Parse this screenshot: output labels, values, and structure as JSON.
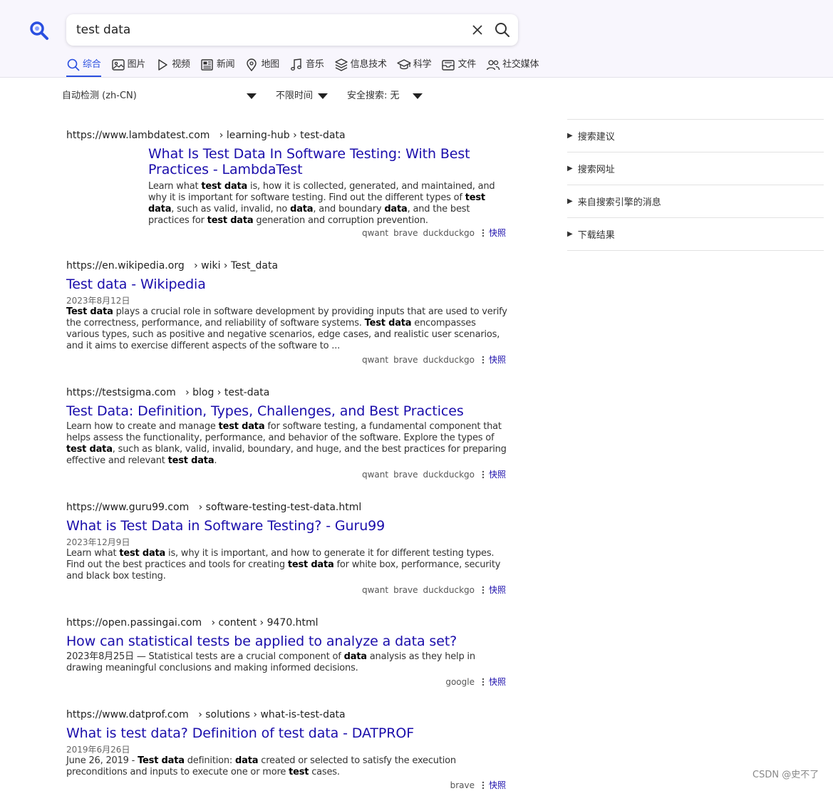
{
  "search": {
    "query": "test data",
    "clear_icon": "close-icon",
    "submit_icon": "search-icon"
  },
  "tabs": [
    {
      "label": "综合",
      "icon": "search-icon",
      "active": true
    },
    {
      "label": "图片",
      "icon": "image-icon"
    },
    {
      "label": "视频",
      "icon": "play-icon"
    },
    {
      "label": "新闻",
      "icon": "newspaper-icon"
    },
    {
      "label": "地图",
      "icon": "map-pin-icon"
    },
    {
      "label": "音乐",
      "icon": "music-icon"
    },
    {
      "label": "信息技术",
      "icon": "layers-icon"
    },
    {
      "label": "科学",
      "icon": "graduation-cap-icon"
    },
    {
      "label": "文件",
      "icon": "inbox-icon"
    },
    {
      "label": "社交媒体",
      "icon": "users-icon"
    }
  ],
  "filters": {
    "language": "自动检测 (zh-CN)",
    "time": "不限时间",
    "safe_search": "安全搜索: 无"
  },
  "results": [
    {
      "domain": "https://www.lambdatest.com",
      "path": "› learning-hub › test-data",
      "title": "What Is Test Data In Software Testing: With Best Practices - LambdaTest",
      "date": "",
      "snippet": "Learn what <b>test data</b> is, how it is collected, generated, and maintained, and why it is important for software testing. Find out the different types of <b>test data</b>, such as valid, invalid, no <b>data</b>, and boundary <b>data</b>, and the best practices for <b>test data</b> generation and corruption prevention.",
      "sources": [
        "qwant",
        "brave",
        "duckduckgo"
      ],
      "snapshot": "快照"
    },
    {
      "domain": "https://en.wikipedia.org",
      "path": "› wiki › Test_data",
      "title": "Test data - Wikipedia",
      "date": "2023年8月12日",
      "snippet": "<b>Test data</b> plays a crucial role in software development by providing inputs that are used to verify the correctness, performance, and reliability of software systems. <b>Test data</b> encompasses various types, such as positive and negative scenarios, edge cases, and realistic user scenarios, and it aims to exercise different aspects of the software to ...",
      "sources": [
        "qwant",
        "brave",
        "duckduckgo"
      ],
      "snapshot": "快照"
    },
    {
      "domain": "https://testsigma.com",
      "path": "› blog › test-data",
      "title": "Test Data: Definition, Types, Challenges, and Best Practices",
      "date": "",
      "snippet": "Learn how to create and manage <b>test data</b> for software testing, a fundamental component that helps assess the functionality, performance, and behavior of the software. Explore the types of <b>test data</b>, such as blank, valid, invalid, boundary, and huge, and the best practices for preparing effective and relevant <b>test data</b>.",
      "sources": [
        "qwant",
        "brave",
        "duckduckgo"
      ],
      "snapshot": "快照"
    },
    {
      "domain": "https://www.guru99.com",
      "path": "› software-testing-test-data.html",
      "title": "What is Test Data in Software Testing? - Guru99",
      "date": "2023年12月9日",
      "snippet": "Learn what <b>test data</b> is, why it is important, and how to generate it for different testing types. Find out the best practices and tools for creating <b>test data</b> for white box, performance, security and black box testing.",
      "sources": [
        "qwant",
        "brave",
        "duckduckgo"
      ],
      "snapshot": "快照"
    },
    {
      "domain": "https://open.passingai.com",
      "path": "› content › 9470.html",
      "title": "How can statistical tests be applied to analyze a data set?",
      "date": "",
      "snippet": "2023年8月25日 — Statistical tests are a crucial component of <b>data</b> analysis as they help in drawing meaningful conclusions and making informed decisions.",
      "sources": [
        "google"
      ],
      "snapshot": "快照"
    },
    {
      "domain": "https://www.datprof.com",
      "path": "› solutions › what-is-test-data",
      "title": "What is test data? Definition of test data - DATPROF",
      "date": "2019年6月26日",
      "snippet": "June 26, 2019 - <b>Test data</b> definition: <b>data</b> created or selected to satisfy the execution preconditions and inputs to execute one or more <b>test</b> cases.",
      "sources": [
        "brave"
      ],
      "snapshot": "快照"
    }
  ],
  "sidebar": [
    "搜索建议",
    "搜索网址",
    "来自搜索引擎的消息",
    "下载结果"
  ],
  "watermark": "CSDN @史不了",
  "colors": {
    "accent": "#2a4fe0",
    "link": "#1a0dab",
    "header_bg": "#f8f6fd"
  }
}
